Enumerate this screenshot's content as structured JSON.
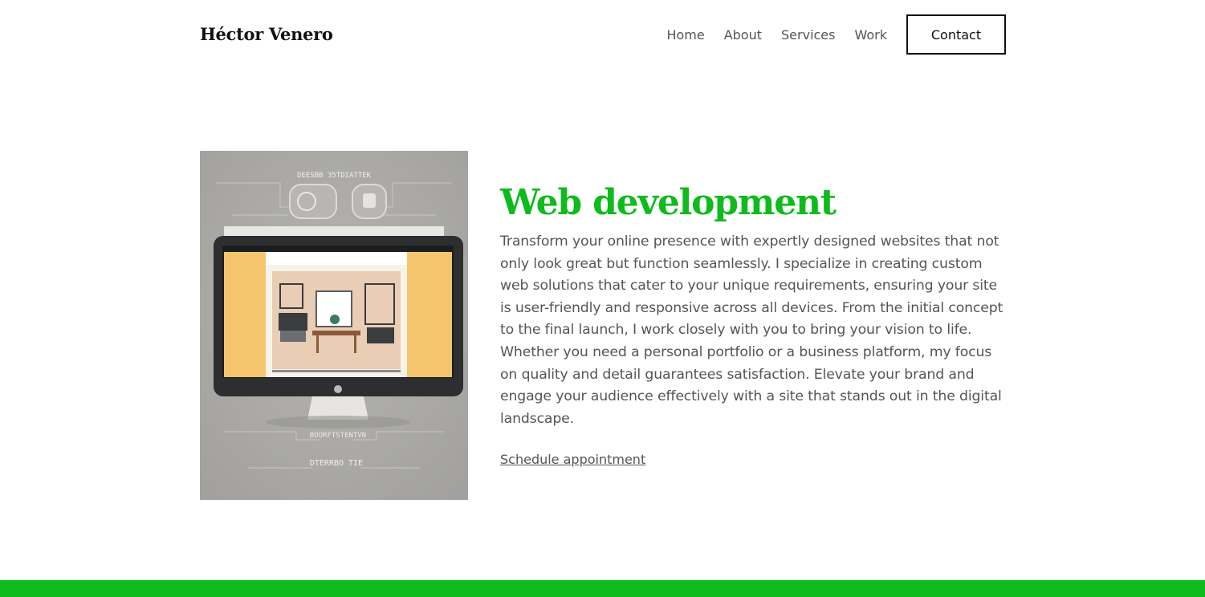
{
  "brand": {
    "name": "Héctor Venero"
  },
  "nav": {
    "items": [
      {
        "label": "Home"
      },
      {
        "label": "About"
      },
      {
        "label": "Services"
      },
      {
        "label": "Work"
      }
    ],
    "contact_label": "Contact"
  },
  "hero_image": {
    "top_text": "DEESBB 35TDIATTEK",
    "bottom_text_1": "BOORFTSTENTVN",
    "bottom_text_2": "DTERRBO TIE",
    "colors": {
      "background": "#a8a7a3",
      "monitor": "#2c2e30",
      "panel": "#f5c56e",
      "room": "#e9cdb4"
    }
  },
  "service": {
    "title": "Web development",
    "description": "Transform your online presence with expertly designed websites that not only look great but function seamlessly. I specialize in creating custom web solutions that cater to your unique requirements, ensuring your site is user-friendly and responsive across all devices. From the initial concept to the final launch, I work closely with you to bring your vision to life. Whether you need a personal portfolio or a business platform, my focus on quality and detail guarantees satisfaction. Elevate your brand and engage your audience effectively with a site that stands out in the digital landscape.",
    "cta_label": "Schedule appointment"
  },
  "theme": {
    "accent": "#0fbb1c",
    "text": "#555555",
    "heading": "#111111"
  }
}
